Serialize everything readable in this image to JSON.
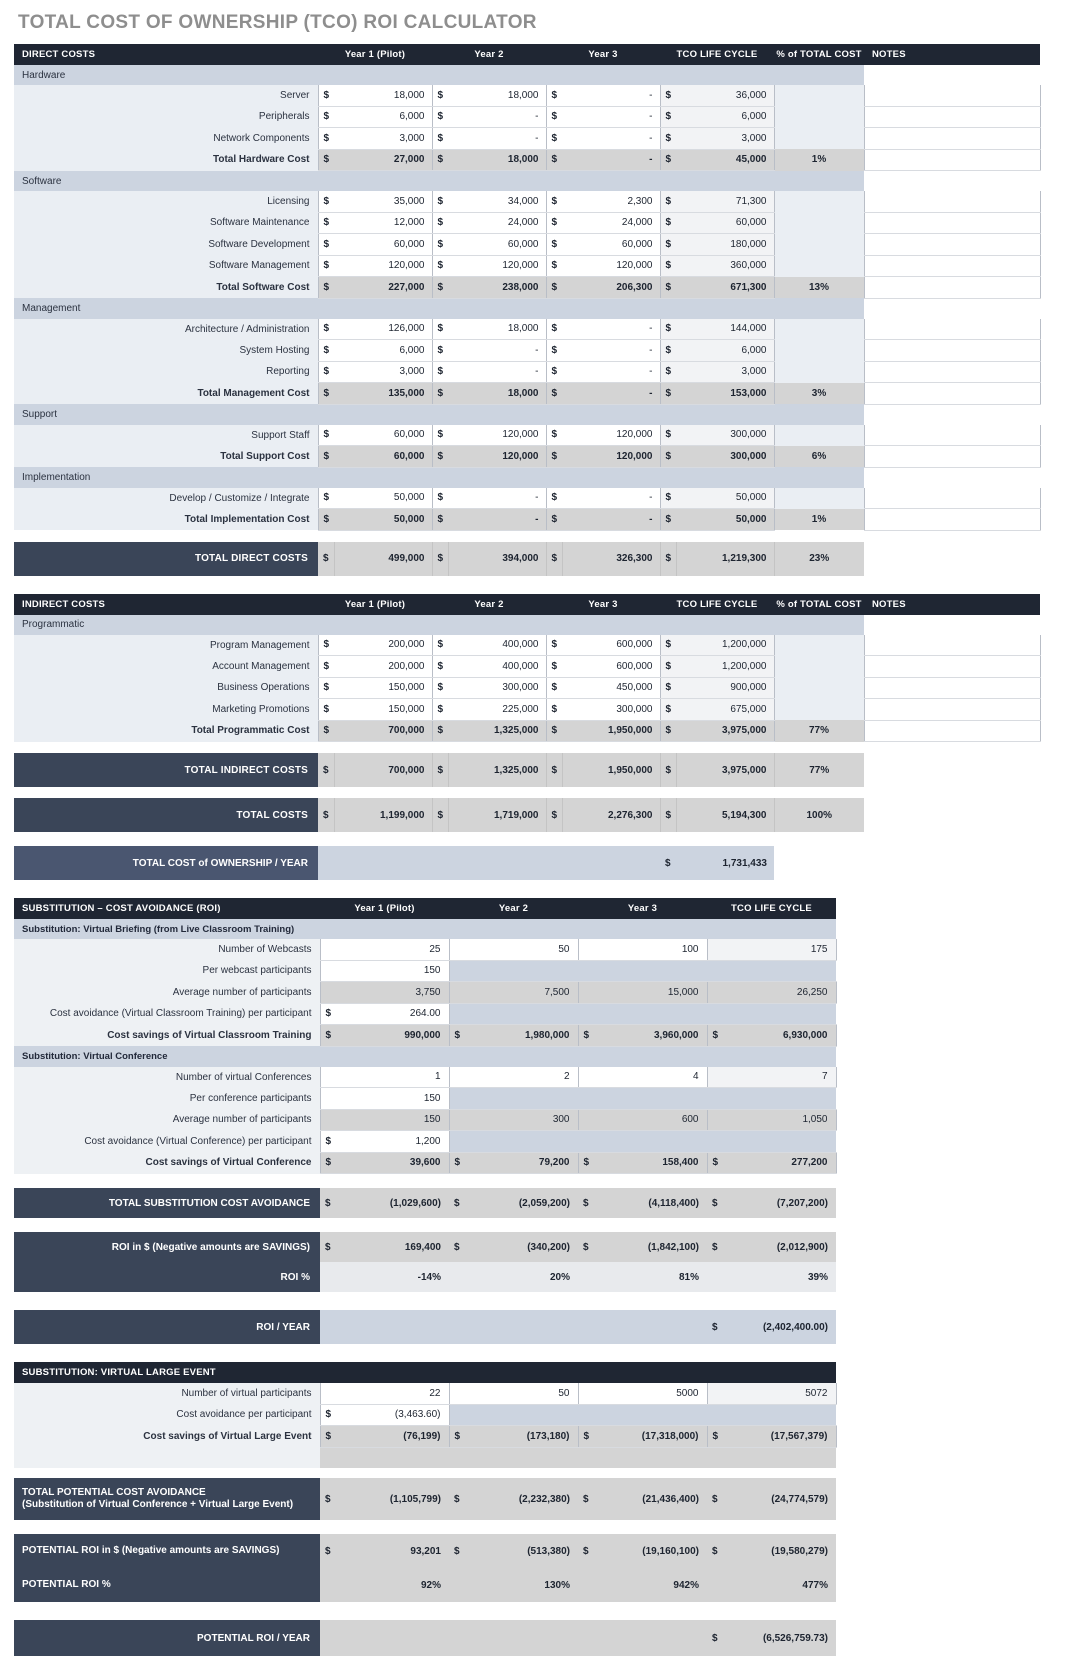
{
  "title": "TOTAL COST OF OWNERSHIP (TCO) ROI CALCULATOR",
  "colors": {
    "header_bar": "#1f2633",
    "total_bar": "#3a4558",
    "group_band": "#ccd4e0",
    "label_col": "#eaeef3",
    "subtotal_fill": "#d4d4d4",
    "title_text": "#8e8e8e"
  },
  "columns": {
    "year1": "Year 1 (Pilot)",
    "year2": "Year 2",
    "year3": "Year 3",
    "lifecycle": "TCO LIFE CYCLE",
    "pct": "% of TOTAL COST",
    "notes": "NOTES",
    "dollar": "$"
  },
  "direct": {
    "header": "DIRECT COSTS",
    "groups": [
      {
        "name": "Hardware",
        "rows": [
          {
            "label": "Server",
            "y1": "18,000",
            "y2": "18,000",
            "y3": "-",
            "life": "36,000"
          },
          {
            "label": "Peripherals",
            "y1": "6,000",
            "y2": "-",
            "y3": "-",
            "life": "6,000"
          },
          {
            "label": "Network Components",
            "y1": "3,000",
            "y2": "-",
            "y3": "-",
            "life": "3,000"
          }
        ],
        "total": {
          "label": "Total Hardware Cost",
          "y1": "27,000",
          "y2": "18,000",
          "y3": "-",
          "life": "45,000",
          "pct": "1%"
        }
      },
      {
        "name": "Software",
        "rows": [
          {
            "label": "Licensing",
            "y1": "35,000",
            "y2": "34,000",
            "y3": "2,300",
            "life": "71,300"
          },
          {
            "label": "Software Maintenance",
            "y1": "12,000",
            "y2": "24,000",
            "y3": "24,000",
            "life": "60,000"
          },
          {
            "label": "Software Development",
            "y1": "60,000",
            "y2": "60,000",
            "y3": "60,000",
            "life": "180,000"
          },
          {
            "label": "Software Management",
            "y1": "120,000",
            "y2": "120,000",
            "y3": "120,000",
            "life": "360,000"
          }
        ],
        "total": {
          "label": "Total Software Cost",
          "y1": "227,000",
          "y2": "238,000",
          "y3": "206,300",
          "life": "671,300",
          "pct": "13%"
        }
      },
      {
        "name": "Management",
        "rows": [
          {
            "label": "Architecture / Administration",
            "y1": "126,000",
            "y2": "18,000",
            "y3": "-",
            "life": "144,000"
          },
          {
            "label": "System Hosting",
            "y1": "6,000",
            "y2": "-",
            "y3": "-",
            "life": "6,000"
          },
          {
            "label": "Reporting",
            "y1": "3,000",
            "y2": "-",
            "y3": "-",
            "life": "3,000"
          }
        ],
        "total": {
          "label": "Total Management Cost",
          "y1": "135,000",
          "y2": "18,000",
          "y3": "-",
          "life": "153,000",
          "pct": "3%"
        }
      },
      {
        "name": "Support",
        "rows": [
          {
            "label": "Support Staff",
            "y1": "60,000",
            "y2": "120,000",
            "y3": "120,000",
            "life": "300,000"
          }
        ],
        "total": {
          "label": "Total Support  Cost",
          "y1": "60,000",
          "y2": "120,000",
          "y3": "120,000",
          "life": "300,000",
          "pct": "6%"
        }
      },
      {
        "name": "Implementation",
        "rows": [
          {
            "label": "Develop / Customize / Integrate",
            "y1": "50,000",
            "y2": "-",
            "y3": "-",
            "life": "50,000"
          }
        ],
        "total": {
          "label": "Total Implementation Cost",
          "y1": "50,000",
          "y2": "-",
          "y3": "-",
          "life": "50,000",
          "pct": "1%"
        }
      }
    ],
    "grand": {
      "label": "TOTAL DIRECT COSTS",
      "y1": "499,000",
      "y2": "394,000",
      "y3": "326,300",
      "life": "1,219,300",
      "pct": "23%"
    }
  },
  "indirect": {
    "header": "INDIRECT COSTS",
    "groups": [
      {
        "name": "Programmatic",
        "rows": [
          {
            "label": "Program Management",
            "y1": "200,000",
            "y2": "400,000",
            "y3": "600,000",
            "life": "1,200,000"
          },
          {
            "label": "Account Management",
            "y1": "200,000",
            "y2": "400,000",
            "y3": "600,000",
            "life": "1,200,000"
          },
          {
            "label": "Business Operations",
            "y1": "150,000",
            "y2": "300,000",
            "y3": "450,000",
            "life": "900,000"
          },
          {
            "label": "Marketing Promotions",
            "y1": "150,000",
            "y2": "225,000",
            "y3": "300,000",
            "life": "675,000"
          }
        ],
        "total": {
          "label": "Total Programmatic Cost",
          "y1": "700,000",
          "y2": "1,325,000",
          "y3": "1,950,000",
          "life": "3,975,000",
          "pct": "77%"
        }
      }
    ],
    "grand": {
      "label": "TOTAL INDIRECT COSTS",
      "y1": "700,000",
      "y2": "1,325,000",
      "y3": "1,950,000",
      "life": "3,975,000",
      "pct": "77%"
    }
  },
  "total_costs": {
    "label": "TOTAL COSTS",
    "y1": "1,199,000",
    "y2": "1,719,000",
    "y3": "2,276,300",
    "life": "5,194,300",
    "pct": "100%"
  },
  "tco_per_year": {
    "label": "TOTAL COST of OWNERSHIP / YEAR",
    "value": "1,731,433"
  },
  "substitution": {
    "header": "SUBSTITUTION – COST AVOIDANCE (ROI)",
    "sections": [
      {
        "name": "Substitution: Virtual Briefing (from Live Classroom Training)",
        "rows": [
          {
            "label": "Number of Webcasts",
            "y1": "25",
            "y2": "50",
            "y3": "100",
            "life": "175"
          },
          {
            "label": "Per webcast participants",
            "y1": "150",
            "y2": "",
            "y3": "",
            "life": ""
          },
          {
            "label": "Average number of participants",
            "y1": "3,750",
            "y2": "7,500",
            "y3": "15,000",
            "life": "26,250"
          },
          {
            "label": "Cost avoidance (Virtual Classroom Training) per participant",
            "y1": "264.00",
            "y2": "",
            "y3": "",
            "life": ""
          }
        ],
        "total": {
          "label": "Cost savings of Virtual Classroom Training",
          "y1": "990,000",
          "y2": "1,980,000",
          "y3": "3,960,000",
          "life": "6,930,000"
        }
      },
      {
        "name": "Substitution: Virtual Conference",
        "rows": [
          {
            "label": "Number of virtual Conferences",
            "y1": "1",
            "y2": "2",
            "y3": "4",
            "life": "7"
          },
          {
            "label": "Per conference participants",
            "y1": "150",
            "y2": "",
            "y3": "",
            "life": ""
          },
          {
            "label": "Average number of participants",
            "y1": "150",
            "y2": "300",
            "y3": "600",
            "life": "1,050"
          },
          {
            "label": "Cost avoidance (Virtual Conference) per participant",
            "y1": "1,200",
            "y2": "",
            "y3": "",
            "life": ""
          }
        ],
        "total": {
          "label": "Cost savings of Virtual Conference",
          "y1": "39,600",
          "y2": "79,200",
          "y3": "158,400",
          "life": "277,200"
        }
      }
    ],
    "total_avoidance": {
      "label": "TOTAL SUBSTITUTION COST AVOIDANCE",
      "y1": "(1,029,600)",
      "y2": "(2,059,200)",
      "y3": "(4,118,400)",
      "life": "(7,207,200)"
    },
    "roi_dollars": {
      "label": "ROI in $  (Negative amounts are SAVINGS)",
      "y1": "169,400",
      "y2": "(340,200)",
      "y3": "(1,842,100)",
      "life": "(2,012,900)"
    },
    "roi_pct": {
      "label": "ROI %",
      "y1": "-14%",
      "y2": "20%",
      "y3": "81%",
      "life": "39%"
    },
    "roi_per_year": {
      "label": "ROI / YEAR",
      "value": "(2,402,400.00)"
    }
  },
  "large_event": {
    "header": "SUBSTITUTION: VIRTUAL LARGE EVENT",
    "rows": [
      {
        "label": "Number of virtual participants",
        "y1": "22",
        "y2": "50",
        "y3": "5000",
        "life": "5072"
      },
      {
        "label": "Cost avoidance per participant",
        "y1": "(3,463.60)",
        "y2": "",
        "y3": "",
        "life": ""
      }
    ],
    "total": {
      "label": "Cost savings of Virtual Large Event",
      "y1": "(76,199)",
      "y2": "(173,180)",
      "y3": "(17,318,000)",
      "life": "(17,567,379)"
    },
    "total_potential": {
      "label_line1": "TOTAL POTENTIAL COST AVOIDANCE",
      "label_line2": "(Substitution of Virtual Conference + Virtual Large Event)",
      "y1": "(1,105,799)",
      "y2": "(2,232,380)",
      "y3": "(21,436,400)",
      "life": "(24,774,579)"
    },
    "potential_roi_dollars": {
      "label": "POTENTIAL ROI in $ (Negative amounts are SAVINGS)",
      "y1": "93,201",
      "y2": "(513,380)",
      "y3": "(19,160,100)",
      "life": "(19,580,279)"
    },
    "potential_roi_pct": {
      "label": "POTENTIAL ROI %",
      "y1": "92%",
      "y2": "130%",
      "y3": "942%",
      "life": "477%"
    },
    "potential_roi_per_year": {
      "label": "POTENTIAL ROI / YEAR",
      "value": "(6,526,759.73)"
    }
  }
}
